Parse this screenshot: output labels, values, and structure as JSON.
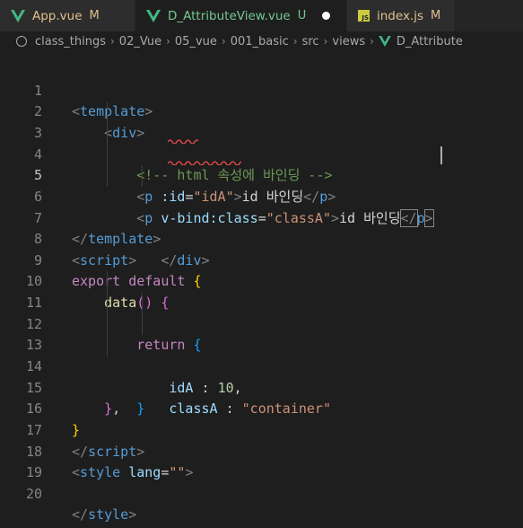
{
  "tabs": [
    {
      "label": "App.vue",
      "status": "M",
      "icon": "vue-icon"
    },
    {
      "label": "D_AttributeView.vue",
      "status": "U",
      "icon": "vue-icon",
      "active": true,
      "unsaved": true
    },
    {
      "label": "index.js",
      "status": "M",
      "icon": "js-icon"
    }
  ],
  "breadcrumb": [
    "class_things",
    "02_Vue",
    "05_vue",
    "001_basic",
    "src",
    "views",
    "D_Attribute"
  ],
  "colors": {
    "modified": "#e2c08d",
    "untracked": "#73c991",
    "vue": "#41b883",
    "squiggle": "#f14c4c"
  },
  "code": {
    "line_numbers": [
      "1",
      "2",
      "3",
      "4",
      "5",
      "6",
      "7",
      "8",
      "9",
      "10",
      "11",
      "12",
      "13",
      "14",
      "15",
      "16",
      "17",
      "18",
      "19",
      "20"
    ],
    "template_open": "template",
    "div": "div",
    "comment": "<!-- html 속성에 바인딩 -->",
    "p": "p",
    "id_attr": ":id",
    "id_value": "\"idA\"",
    "id_text": "id 바인딩",
    "vbind_attr": "v-bind:class",
    "class_value": "\"classA\"",
    "class_text": "id 바인딩",
    "script": "script",
    "export": "export",
    "default": "default",
    "data_fn": "data",
    "return_kw": "return",
    "idA_key": "idA",
    "idA_val": "10",
    "classA_key": "classA",
    "classA_val": "\"container\"",
    "style": "style",
    "lang_attr": "lang",
    "lang_value": "\"\""
  },
  "js_icon_text": "JS"
}
